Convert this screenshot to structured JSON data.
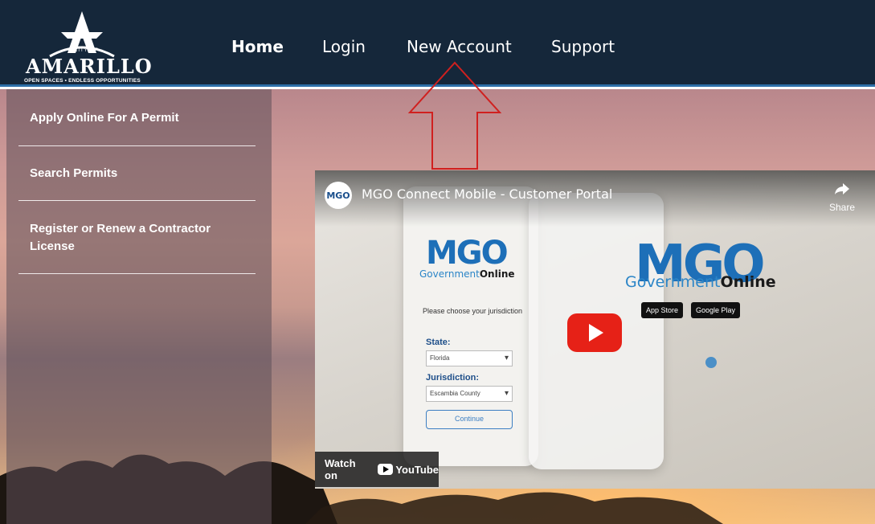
{
  "header": {
    "logo_city": "CITY OF",
    "logo_name": "AMARILLO",
    "logo_tagline": "OPEN SPACES • ENDLESS OPPORTUNITIES",
    "nav": [
      {
        "label": "Home",
        "active": true
      },
      {
        "label": "Login",
        "active": false
      },
      {
        "label": "New Account",
        "active": false
      },
      {
        "label": "Support",
        "active": false
      }
    ]
  },
  "sidebar": {
    "items": [
      {
        "label": "Apply Online For A Permit"
      },
      {
        "label": "Search Permits"
      },
      {
        "label": "Register or Renew a Contractor License"
      }
    ]
  },
  "video": {
    "channel": "MGO",
    "title": "MGO Connect Mobile - Customer Portal",
    "share_label": "Share",
    "watch_label": "Watch on",
    "youtube_label": "YouTube",
    "content": {
      "logo": "MGO",
      "gov_text": "Government",
      "gov_bold": "Online",
      "choose": "Please choose your jurisdiction",
      "state_label": "State:",
      "state_value": "Florida",
      "juris_label": "Jurisdiction:",
      "juris_value": "Escambia County",
      "continue": "Continue",
      "app_store": "App Store",
      "google_play": "Google Play"
    }
  },
  "colors": {
    "header_bg": "#15273a",
    "accent": "#2d6fa8",
    "arrow": "#d0201f",
    "youtube_red": "#e62117"
  }
}
